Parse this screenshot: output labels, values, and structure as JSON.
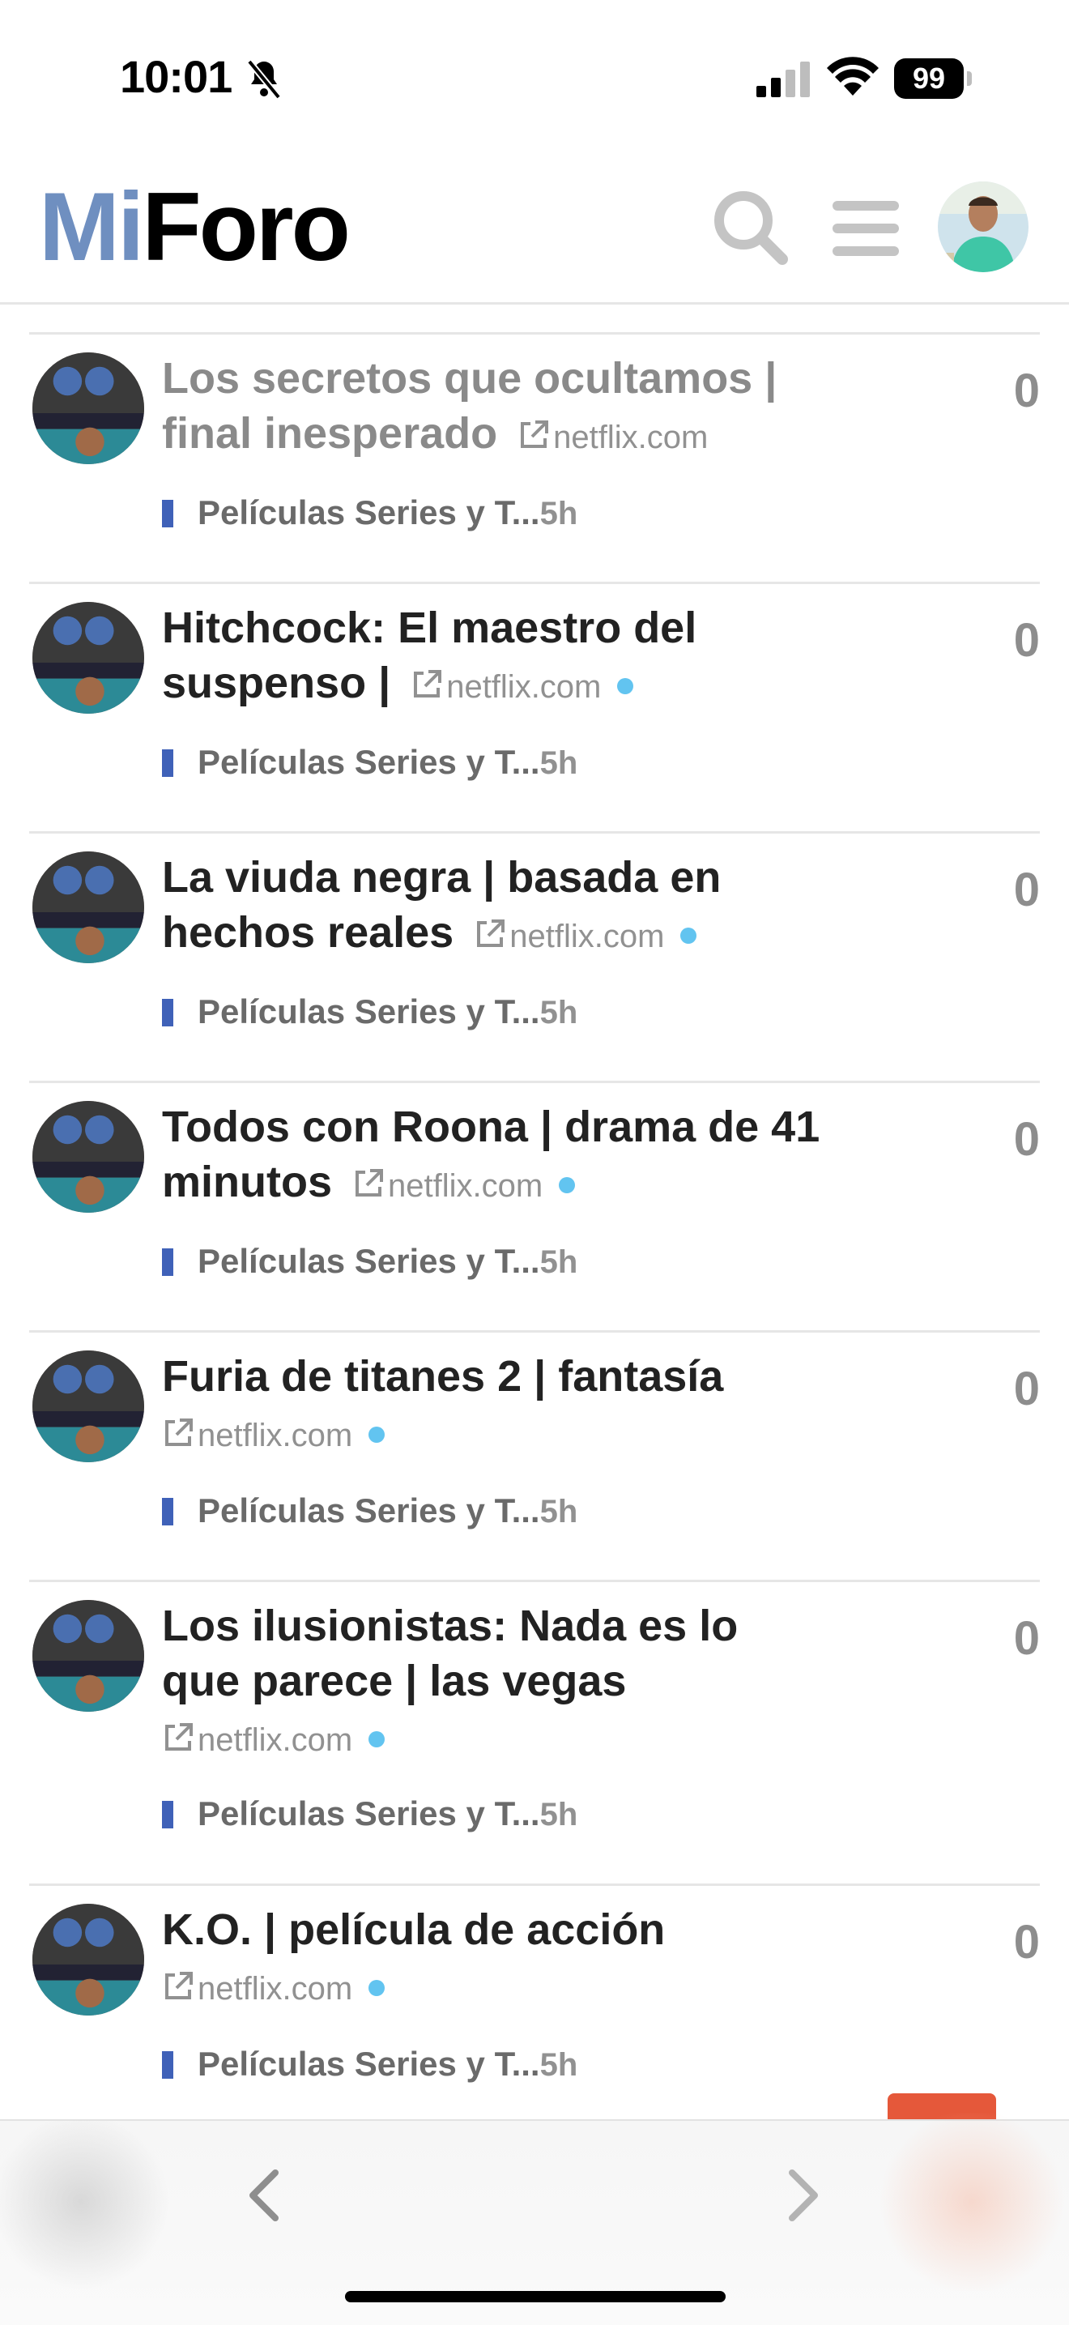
{
  "status_bar": {
    "time": "10:01",
    "battery": "99"
  },
  "header": {
    "logo_part1": "Mi",
    "logo_part2": "Foro"
  },
  "topics": [
    {
      "title": "Los secretos que ocultamos | final inesperado",
      "domain": "netflix.com",
      "category": "Películas Series y T...",
      "age": "5h",
      "replies": "0",
      "read": true
    },
    {
      "title": "Hitchcock: El maestro del suspenso |",
      "domain": "netflix.com",
      "category": "Películas Series y T...",
      "age": "5h",
      "replies": "0",
      "read": false
    },
    {
      "title": "La viuda negra | basada en hechos reales",
      "domain": "netflix.com",
      "category": "Películas Series y T...",
      "age": "5h",
      "replies": "0",
      "read": false
    },
    {
      "title": "Todos con Roona | drama de 41 minutos",
      "domain": "netflix.com",
      "category": "Películas Series y T...",
      "age": "5h",
      "replies": "0",
      "read": false
    },
    {
      "title": "Furia de titanes 2 | fantasía",
      "domain": "netflix.com",
      "category": "Películas Series y T...",
      "age": "5h",
      "replies": "0",
      "read": false
    },
    {
      "title": "Los ilusionistas: Nada es lo que parece | las vegas",
      "domain": "netflix.com",
      "category": "Películas Series y T...",
      "age": "5h",
      "replies": "0",
      "read": false
    },
    {
      "title": "K.O. | película de acción",
      "domain": "netflix.com",
      "category": "Películas Series y T...",
      "age": "5h",
      "replies": "0",
      "read": false
    }
  ],
  "colors": {
    "accent": "#6f8fc0",
    "category": "#3f61b8",
    "unread_dot": "#62c4f0",
    "fab": "#e5583a"
  }
}
